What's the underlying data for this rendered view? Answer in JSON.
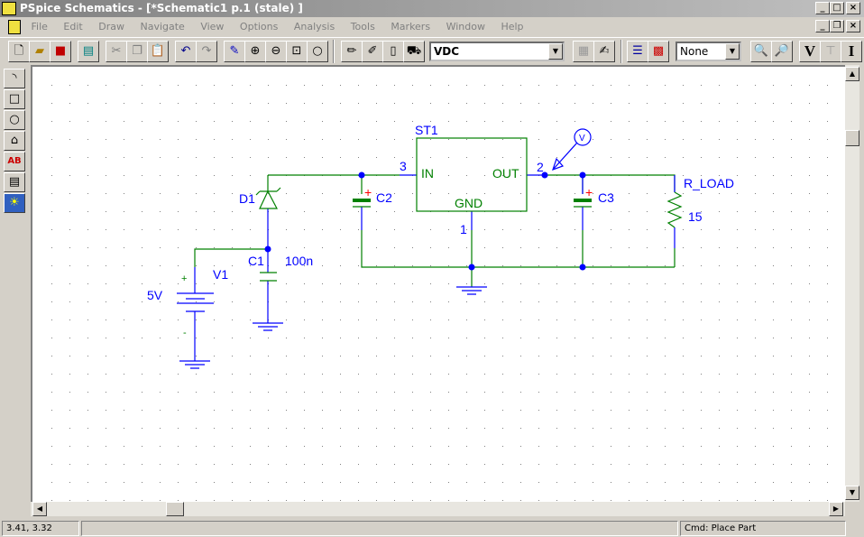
{
  "window": {
    "title": "PSpice Schematics - [*Schematic1  p.1 (stale)  ]"
  },
  "menu": [
    "File",
    "Edit",
    "Draw",
    "Navigate",
    "View",
    "Options",
    "Analysis",
    "Tools",
    "Markers",
    "Window",
    "Help"
  ],
  "toolbar": {
    "part_combo": "VDC",
    "marker_combo": "None",
    "v_button": "V",
    "i_button": "I"
  },
  "schematic": {
    "st1": {
      "name": "ST1",
      "pin_in": "IN",
      "pin_out": "OUT",
      "pin_gnd": "GND",
      "pin3": "3",
      "pin2": "2",
      "pin1": "1"
    },
    "d1": "D1",
    "c1": "C1",
    "c1_value": "100n",
    "c2": "C2",
    "c3": "C3",
    "v1": "V1",
    "v1_value": "5V",
    "v1_plus": "+",
    "v1_minus": "-",
    "cap_plus": "+",
    "r_load": "R_LOAD",
    "r_value": "15",
    "marker": "V"
  },
  "colors": {
    "wire": "#008000",
    "pin": "#0000ff",
    "label": "#0000ff",
    "polarity": "#ff0000"
  },
  "status": {
    "coords": "3.41,  3.32",
    "message": "",
    "command": "Cmd: Place Part"
  }
}
